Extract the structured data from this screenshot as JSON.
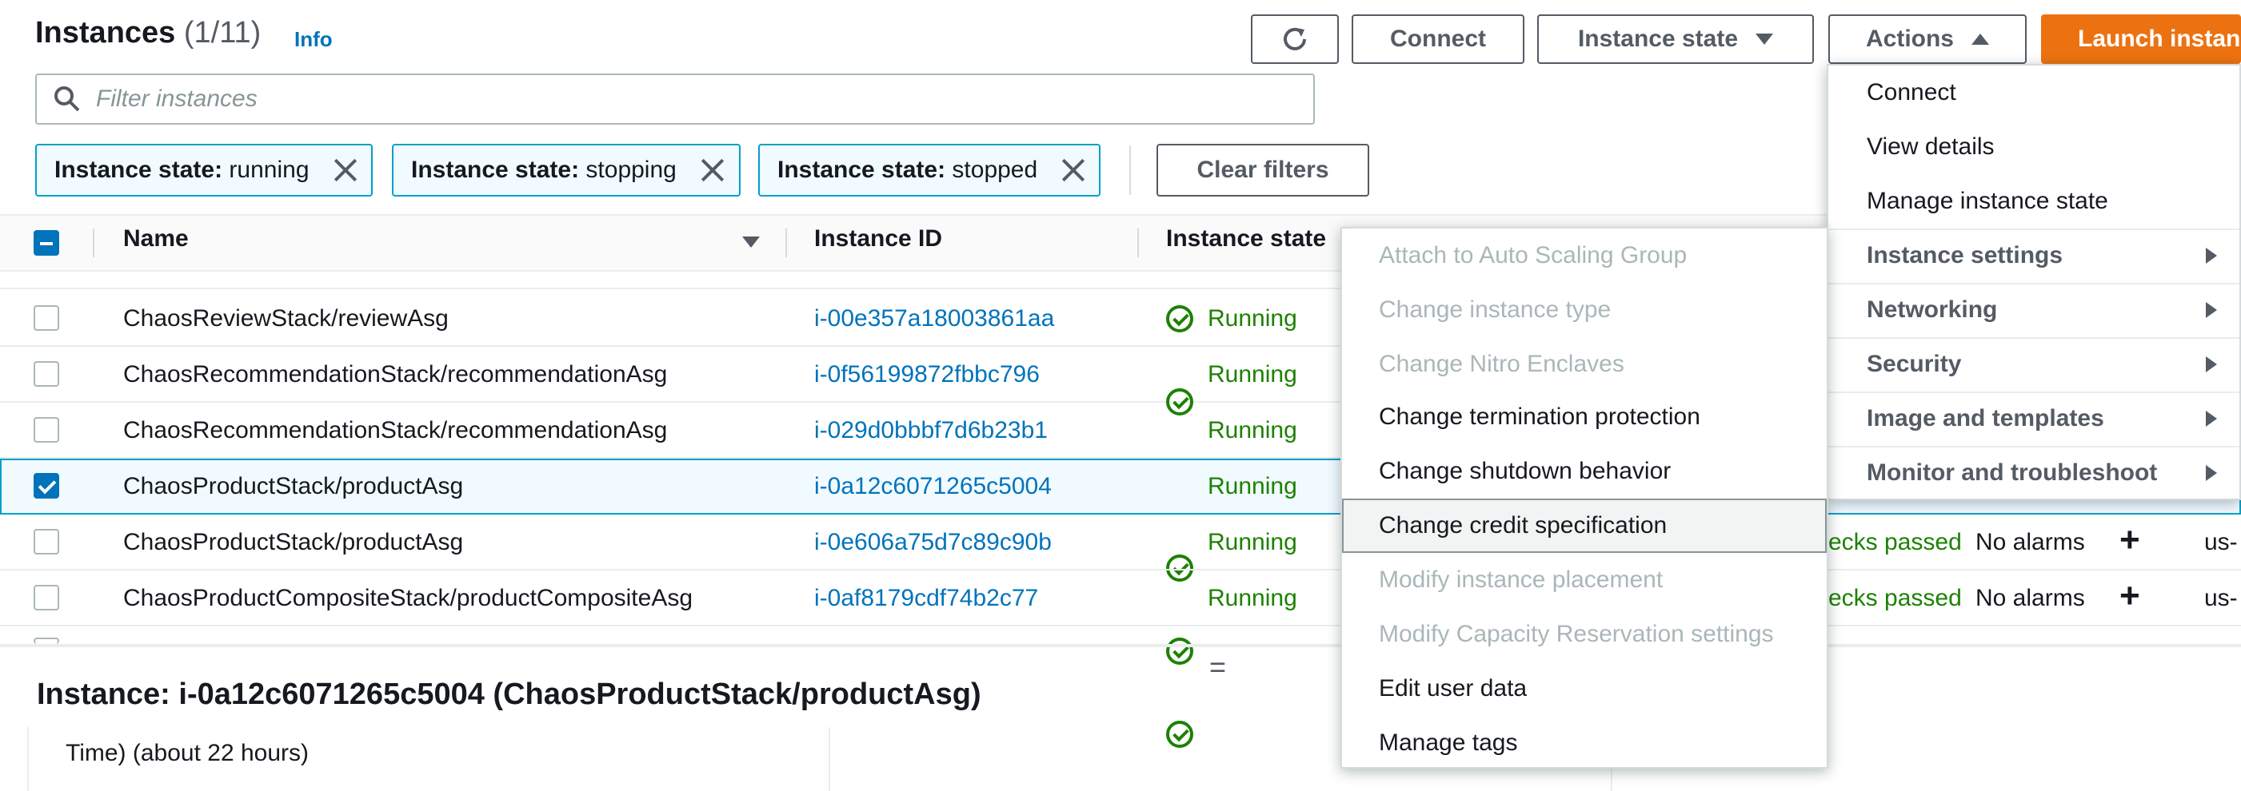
{
  "header": {
    "title": "Instances",
    "count": "(1/11)",
    "info_label": "Info",
    "connect_label": "Connect",
    "instance_state_label": "Instance state",
    "actions_label": "Actions",
    "launch_label": "Launch instan"
  },
  "filter": {
    "placeholder": "Filter instances",
    "tokens": [
      {
        "key": "Instance state:",
        "value": "running"
      },
      {
        "key": "Instance state:",
        "value": "stopping"
      },
      {
        "key": "Instance state:",
        "value": "stopped"
      }
    ],
    "clear_label": "Clear filters"
  },
  "table": {
    "columns": {
      "name": "Name",
      "instance_id": "Instance ID",
      "instance_state": "Instance state"
    },
    "rows": [
      {
        "name": "ChaosReviewStack/reviewAsg",
        "id": "i-00e357a18003861aa",
        "state": "Running",
        "selected": false
      },
      {
        "name": "ChaosRecommendationStack/recommendationAsg",
        "id": "i-0f56199872fbbc796",
        "state": "Running",
        "selected": false
      },
      {
        "name": "ChaosRecommendationStack/recommendationAsg",
        "id": "i-029d0bbbf7d6b23b1",
        "state": "Running",
        "selected": false
      },
      {
        "name": "ChaosProductStack/productAsg",
        "id": "i-0a12c6071265c5004",
        "state": "Running",
        "selected": true
      },
      {
        "name": "ChaosProductStack/productAsg",
        "id": "i-0e606a75d7c89c90b",
        "state": "Running",
        "selected": false,
        "status": "ecks passed",
        "alarms": "No alarms",
        "az": "us-"
      },
      {
        "name": "ChaosProductCompositeStack/productCompositeAsg",
        "id": "i-0af8179cdf74b2c77",
        "state": "Running",
        "selected": false,
        "status": "ecks passed",
        "alarms": "No alarms",
        "az": "us-"
      }
    ]
  },
  "actions_menu": {
    "items": [
      "Connect",
      "View details",
      "Manage instance state"
    ],
    "submenus": [
      "Instance settings",
      "Networking",
      "Security",
      "Image and templates",
      "Monitor and troubleshoot"
    ]
  },
  "instance_settings_menu": {
    "items": [
      {
        "label": "Attach to Auto Scaling Group",
        "disabled": true
      },
      {
        "label": "Change instance type",
        "disabled": true
      },
      {
        "label": "Change Nitro Enclaves",
        "disabled": true
      },
      {
        "label": "Change termination protection",
        "disabled": false
      },
      {
        "label": "Change shutdown behavior",
        "disabled": false
      },
      {
        "label": "Change credit specification",
        "disabled": false,
        "highlighted": true
      },
      {
        "label": "Modify instance placement",
        "disabled": true
      },
      {
        "label": "Modify Capacity Reservation settings",
        "disabled": true
      },
      {
        "label": "Edit user data",
        "disabled": false
      },
      {
        "label": "Manage tags",
        "disabled": false
      }
    ]
  },
  "detail": {
    "title": "Instance: i-0a12c6071265c5004 (ChaosProductStack/productAsg)",
    "partial_text": "Time) (about 22 hours)",
    "split_handle": "="
  }
}
